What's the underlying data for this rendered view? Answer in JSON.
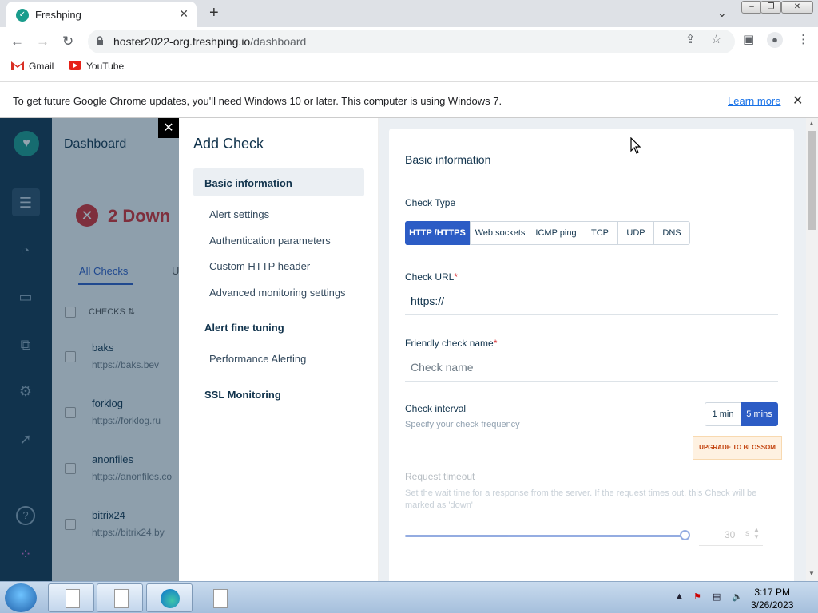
{
  "browser": {
    "tab_title": "Freshping",
    "url_host": "hoster2022-org.freshping.io",
    "url_path": "/dashboard",
    "bookmarks": [
      "Gmail",
      "YouTube"
    ],
    "infobar_message": "To get future Google Chrome updates, you'll need Windows 10 or later. This computer is using Windows 7.",
    "infobar_link": "Learn more"
  },
  "dashboard": {
    "title": "Dashboard",
    "down_count": "2 Down",
    "tab_all": "All Checks",
    "tab_partial": "U",
    "header_checks": "CHECKS",
    "checks": [
      {
        "name": "baks",
        "url": "https://baks.bev"
      },
      {
        "name": "forklog",
        "url": "https://forklog.ru"
      },
      {
        "name": "anonfiles",
        "url": "https://anonfiles.co"
      },
      {
        "name": "bitrix24",
        "url": "https://bitrix24.by"
      }
    ]
  },
  "panel": {
    "title": "Add Check",
    "nav": {
      "basic": "Basic information",
      "alert_settings": "Alert settings",
      "auth": "Authentication parameters",
      "custom_header": "Custom HTTP header",
      "advanced": "Advanced monitoring settings",
      "fine_tuning": "Alert fine tuning",
      "performance": "Performance Alerting",
      "ssl": "SSL Monitoring"
    },
    "section_title": "Basic information",
    "check_type_label": "Check Type",
    "check_types": [
      "HTTP /HTTPS",
      "Web sockets",
      "ICMP ping",
      "TCP",
      "UDP",
      "DNS"
    ],
    "check_url_label": "Check URL",
    "check_url_value": "https://",
    "friendly_label": "Friendly check name",
    "friendly_placeholder": "Check name",
    "interval_label": "Check interval",
    "interval_hint": "Specify your check frequency",
    "interval_options": [
      "1 min",
      "5 mins"
    ],
    "upgrade_label": "UPGRADE TO BLOSSOM",
    "timeout_label": "Request timeout",
    "timeout_hint": "Set the wait time for a response from the server. If the request times out, this Check will be marked as 'down'",
    "timeout_value": "30",
    "timeout_unit": "s"
  },
  "taskbar": {
    "time": "3:17 PM",
    "date": "3/26/2023"
  },
  "colors": {
    "primary": "#2c5cc5",
    "navy": "#12344d",
    "error": "#d72d30",
    "brand": "#1a9c8c"
  }
}
